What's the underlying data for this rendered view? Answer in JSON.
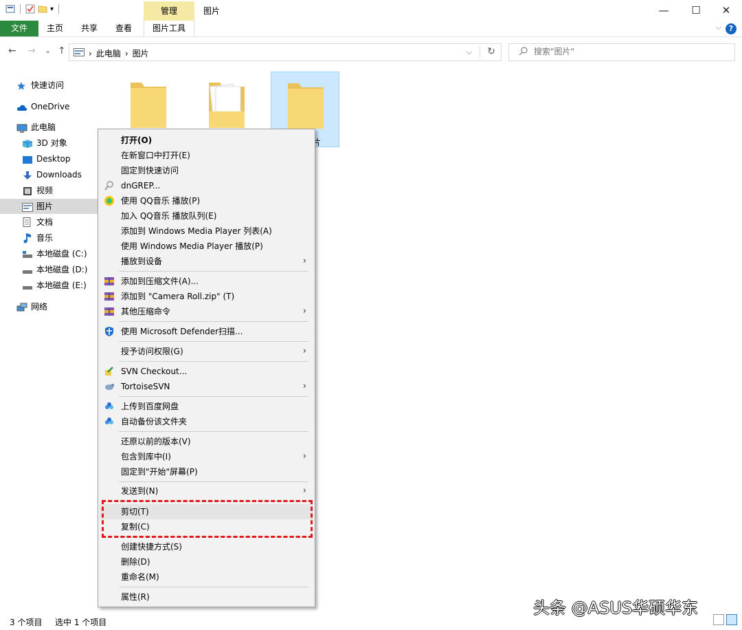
{
  "window": {
    "title": "图片",
    "context_tab": "管理",
    "controls": {
      "minimize": "—",
      "maximize": "☐",
      "close": "✕"
    }
  },
  "ribbon": {
    "tabs": [
      {
        "label": "文件"
      },
      {
        "label": "主页"
      },
      {
        "label": "共享"
      },
      {
        "label": "查看"
      },
      {
        "label": "图片工具"
      }
    ],
    "help": "?",
    "expand": "⌵"
  },
  "nav": {
    "back": "←",
    "forward": "→",
    "recent": "⌄",
    "up": "↑",
    "breadcrumb": [
      "此电脑",
      "图片"
    ],
    "breadcrumb_sep": "›",
    "dropdown": "⌵",
    "refresh": "↻"
  },
  "search": {
    "placeholder": "搜索\"图片\"",
    "icon": "search-icon"
  },
  "sidebar": {
    "items": [
      {
        "label": "快速访问",
        "icon": "star-icon"
      },
      {
        "label": "OneDrive",
        "icon": "cloud-icon"
      },
      {
        "label": "此电脑",
        "icon": "computer-icon"
      },
      {
        "label": "3D 对象",
        "icon": "cube-icon"
      },
      {
        "label": "Desktop",
        "icon": "desktop-icon"
      },
      {
        "label": "Downloads",
        "icon": "download-icon"
      },
      {
        "label": "视频",
        "icon": "video-icon"
      },
      {
        "label": "图片",
        "icon": "pictures-icon"
      },
      {
        "label": "文档",
        "icon": "document-icon"
      },
      {
        "label": "音乐",
        "icon": "music-icon"
      },
      {
        "label": "本地磁盘 (C:)",
        "icon": "drive-c-icon"
      },
      {
        "label": "本地磁盘 (D:)",
        "icon": "drive-icon"
      },
      {
        "label": "本地磁盘 (E:)",
        "icon": "drive-icon"
      },
      {
        "label": "网络",
        "icon": "network-icon"
      }
    ]
  },
  "folders": [
    {
      "label": ""
    },
    {
      "label": ""
    },
    {
      "label": "片"
    }
  ],
  "context_menu": {
    "items": [
      {
        "label": "打开(O)"
      },
      {
        "label": "在新窗口中打开(E)"
      },
      {
        "label": "固定到快速访问"
      },
      {
        "label": "dnGREP..."
      },
      {
        "label": "使用 QQ音乐 播放(P)"
      },
      {
        "label": "加入 QQ音乐 播放队列(E)"
      },
      {
        "label": "添加到 Windows Media Player 列表(A)"
      },
      {
        "label": "使用 Windows Media Player 播放(P)"
      },
      {
        "label": "播放到设备"
      },
      {
        "label": "添加到压缩文件(A)..."
      },
      {
        "label": "添加到 \"Camera Roll.zip\" (T)"
      },
      {
        "label": "其他压缩命令"
      },
      {
        "label": "使用 Microsoft Defender扫描..."
      },
      {
        "label": "授予访问权限(G)"
      },
      {
        "label": "SVN Checkout..."
      },
      {
        "label": "TortoiseSVN"
      },
      {
        "label": "上传到百度网盘"
      },
      {
        "label": "自动备份该文件夹"
      },
      {
        "label": "还原以前的版本(V)"
      },
      {
        "label": "包含到库中(I)"
      },
      {
        "label": "固定到\"开始\"屏幕(P)"
      },
      {
        "label": "发送到(N)"
      },
      {
        "label": "剪切(T)"
      },
      {
        "label": "复制(C)"
      },
      {
        "label": "创建快捷方式(S)"
      },
      {
        "label": "删除(D)"
      },
      {
        "label": "重命名(M)"
      },
      {
        "label": "属性(R)"
      }
    ],
    "submenu_arrow": "›"
  },
  "status": {
    "count": "3 个项目",
    "selected": "选中 1 个项目"
  },
  "watermark": "头条 @ASUS华硕华东",
  "colors": {
    "file_tab": "#2b8a3e",
    "context_tab": "#f6e9a6",
    "selection": "#cce8ff",
    "highlight_box": "#e0191c",
    "folder": "#f8d775"
  }
}
